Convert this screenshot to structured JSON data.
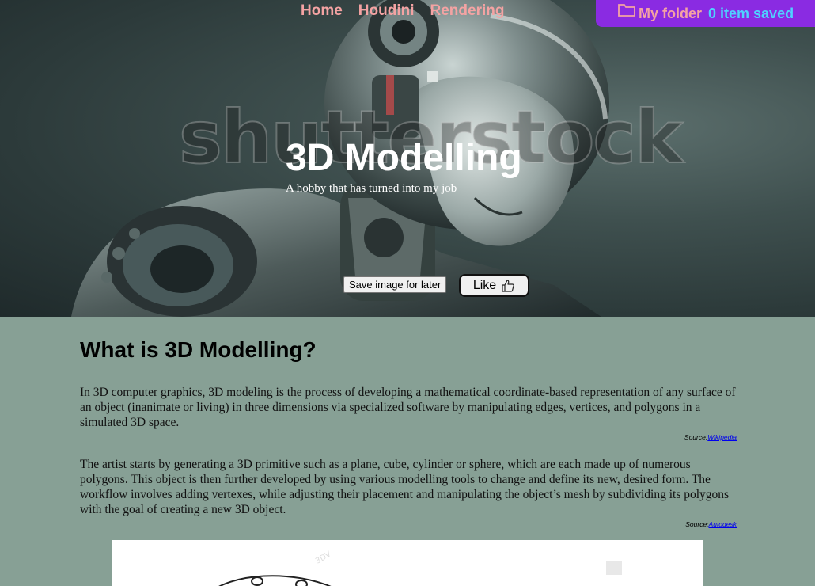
{
  "nav": {
    "items": [
      {
        "label": "Home"
      },
      {
        "label": "Houdini"
      },
      {
        "label": "Rendering"
      }
    ]
  },
  "folder": {
    "label": "My folder",
    "count_text": "0 item saved"
  },
  "hero": {
    "watermark": "shutterstock",
    "title": "3D Modelling",
    "subtitle": "A hobby that has turned into my job",
    "save_button": "Save image for later",
    "like_button": "Like"
  },
  "main": {
    "heading": "What is 3D Modelling?",
    "paragraphs": [
      {
        "text": "In 3D computer graphics, 3D modeling is the process of developing a mathematical coordinate-based representation of any surface of an object (inanimate or living) in three dimensions via specialized software by manipulating edges, vertices, and polygons in a simulated 3D space.",
        "source_prefix": "Source:",
        "source_link": "Wikipedia"
      },
      {
        "text": "The artist starts by generating a 3D primitive such as a plane, cube, cylinder or sphere, which are each made up of numerous polygons. This object is then further developed by using various modelling tools to change and define its new, desired form. The workflow involves adding vertexes, while adjusting their placement and manipulating the object’s mesh by subdividing its polygons with the goal of creating a new 3D object.",
        "source_prefix": "Source:",
        "source_link": "Autodesk"
      }
    ]
  },
  "colors": {
    "nav_link": "#f4a3a3",
    "folder_bg": "#8a2be2",
    "folder_count": "#4fd1ff",
    "content_bg": "#87a095"
  },
  "icons": {
    "folder": "folder-icon",
    "like": "thumbs-up-icon"
  }
}
